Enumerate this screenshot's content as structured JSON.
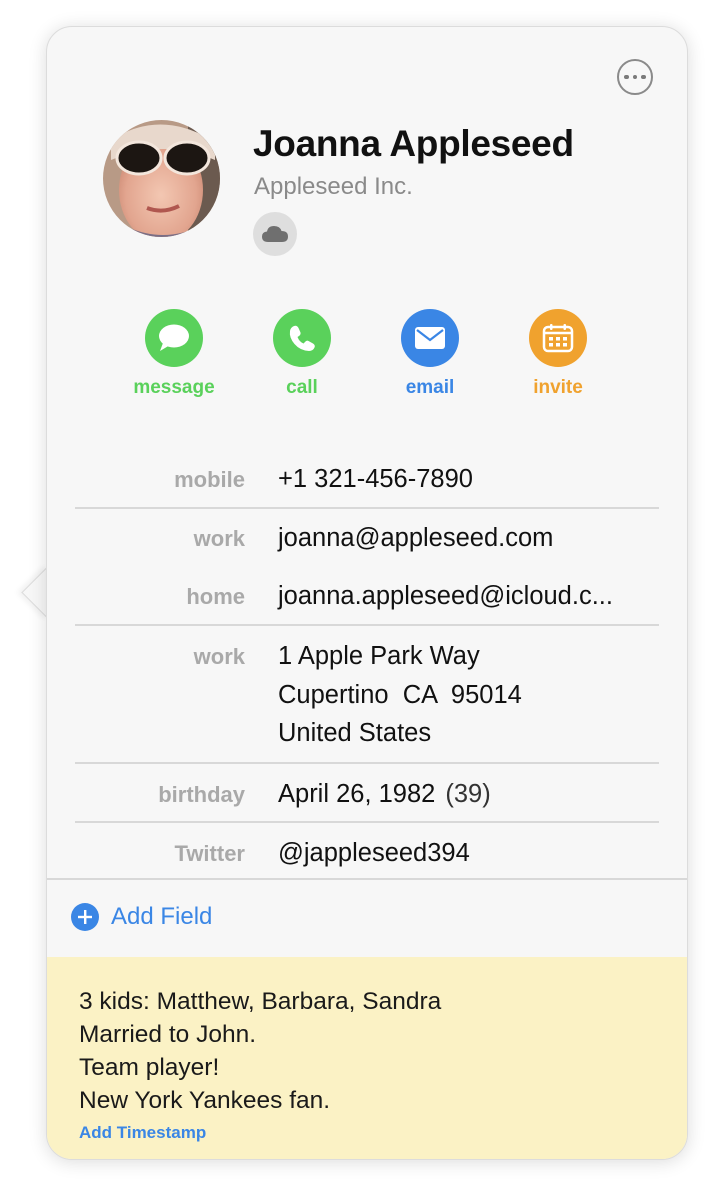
{
  "contact": {
    "name": "Joanna Appleseed",
    "company": "Appleseed Inc.",
    "account_icon": "cloud-icon"
  },
  "header": {
    "more_icon": "ellipsis-circle-icon"
  },
  "actions": [
    {
      "label": "message",
      "icon": "message-bubble-icon",
      "color": "#5ad15b"
    },
    {
      "label": "call",
      "icon": "phone-icon",
      "color": "#5ad15b"
    },
    {
      "label": "email",
      "icon": "envelope-icon",
      "color": "#3a86e5"
    },
    {
      "label": "invite",
      "icon": "calendar-icon",
      "color": "#f0a22e"
    }
  ],
  "fields": {
    "mobile": {
      "label": "mobile",
      "value": "+1 321-456-7890"
    },
    "work_email": {
      "label": "work",
      "value": "joanna@appleseed.com"
    },
    "home_email": {
      "label": "home",
      "value": "joanna.appleseed@icloud.c..."
    },
    "work_address": {
      "label": "work",
      "lines": [
        "1 Apple Park Way",
        "Cupertino  CA  95014",
        "United States"
      ]
    },
    "birthday": {
      "label": "birthday",
      "value": "April 26, 1982",
      "age": "(39)"
    },
    "twitter": {
      "label": "Twitter",
      "value": "@jappleseed394"
    }
  },
  "add_field": {
    "label": "Add Field",
    "icon": "plus-circle-icon"
  },
  "notes": {
    "lines": [
      "3 kids: Matthew, Barbara, Sandra",
      "Married to John.",
      "Team player!",
      "New York Yankees fan."
    ],
    "timestamp_label": "Add Timestamp",
    "background": "#fbf2c5"
  },
  "colors": {
    "accent": "#3a86e5",
    "green": "#5ad15b",
    "orange": "#f0a22e"
  }
}
